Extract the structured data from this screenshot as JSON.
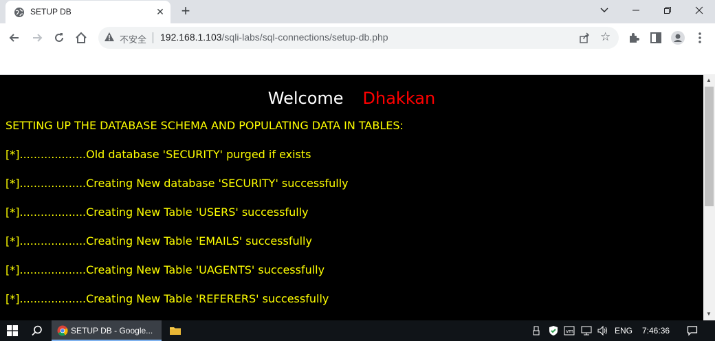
{
  "browser": {
    "tab_title": "SETUP DB",
    "tab_close": "✕",
    "new_tab": "+",
    "insecure_label": "不安全",
    "url_host": "192.168.1.103",
    "url_path": "/sqli-labs/sql-connections/setup-db.php"
  },
  "page": {
    "welcome": "Welcome",
    "user": "Dhakkan",
    "heading": "SETTING UP THE DATABASE SCHEMA AND POPULATING DATA IN TABLES:",
    "lines": [
      "[*]...................Old database 'SECURITY' purged if exists",
      "[*]...................Creating New database 'SECURITY' successfully",
      "[*]...................Creating New Table 'USERS' successfully",
      "[*]...................Creating New Table 'EMAILS' successfully",
      "[*]...................Creating New Table 'UAGENTS' successfully",
      "[*]...................Creating New Table 'REFERERS' successfully"
    ]
  },
  "taskbar": {
    "chrome_label": "SETUP DB - Google...",
    "language": "ENG",
    "time": "7:46:36"
  },
  "colors": {
    "page_bg": "#000000",
    "text_yellow": "#ffff00",
    "user_red": "#ff0000"
  }
}
